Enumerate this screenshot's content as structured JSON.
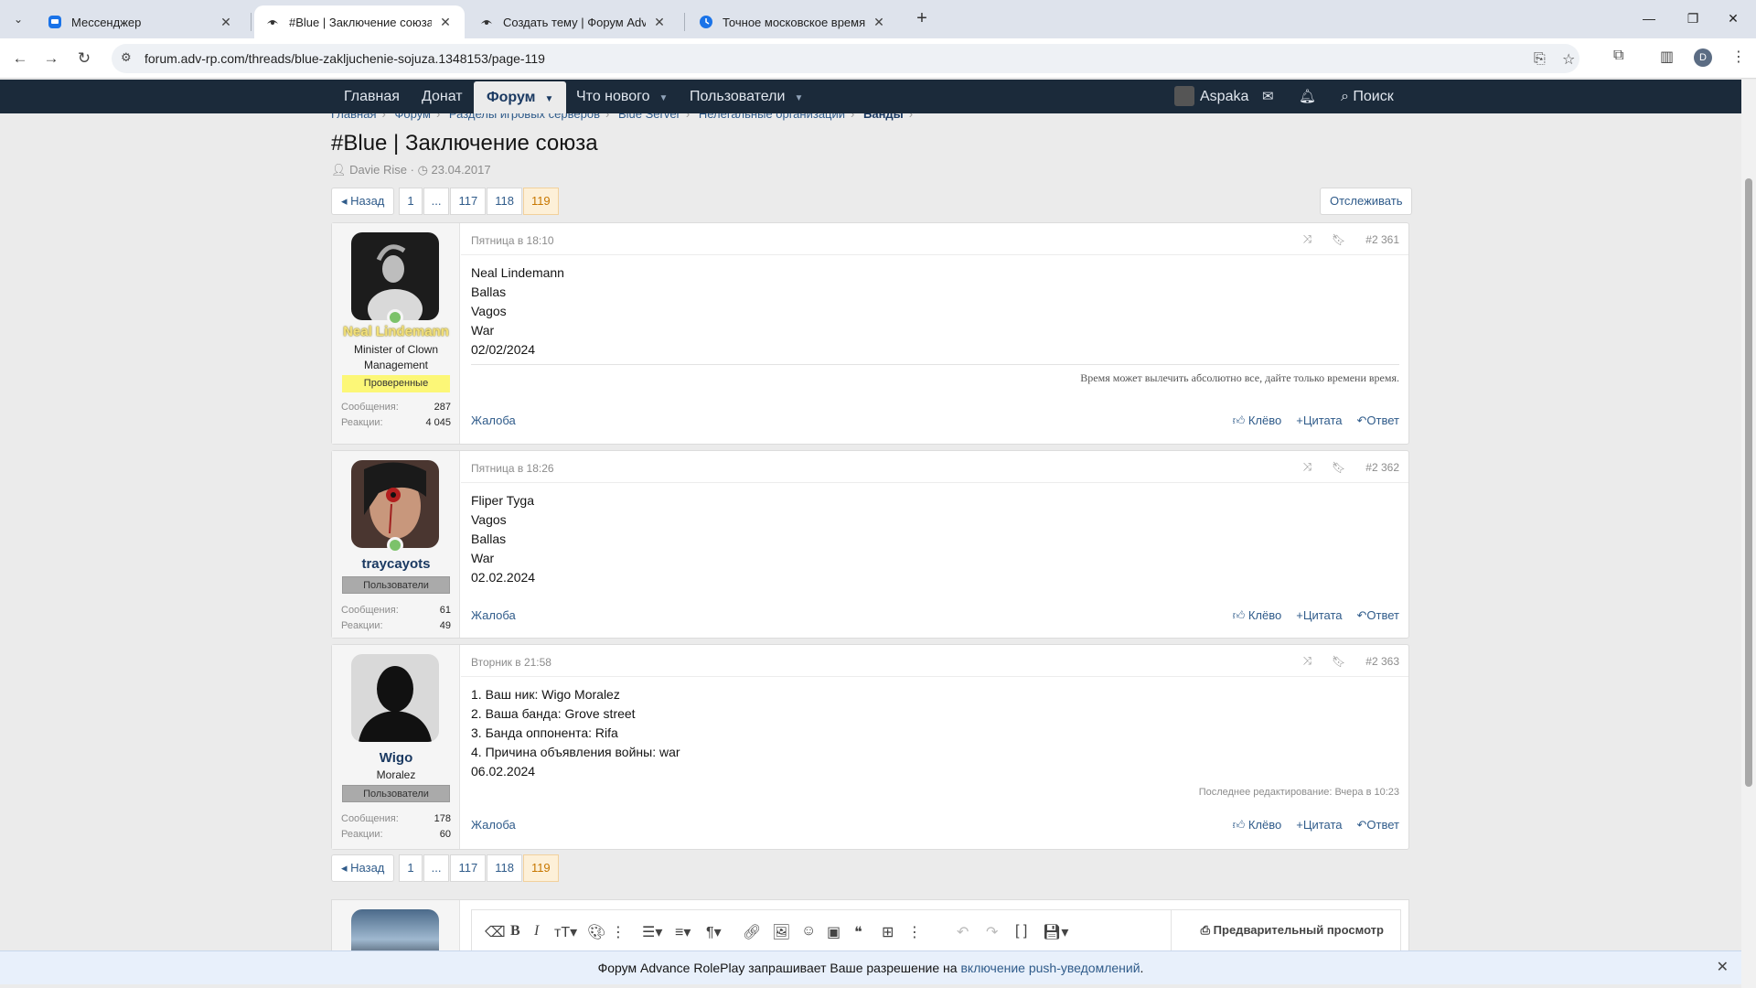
{
  "browser": {
    "tabs": [
      {
        "title": "Мессенджер",
        "favicon": "messenger-icon"
      },
      {
        "title": "#Blue | Заключение союза | Ст",
        "favicon": "forum-icon"
      },
      {
        "title": "Создать тему | Форум Advance",
        "favicon": "forum-icon"
      },
      {
        "title": "Точное московское время",
        "favicon": "clock-icon"
      }
    ],
    "url": "forum.adv-rp.com/threads/blue-zakljuchenie-sojuza.1348153/page-119",
    "profile_initial": "D"
  },
  "nav": {
    "items": [
      "Главная",
      "Донат",
      "Форум",
      "Что нового",
      "Пользователи"
    ],
    "user": "Aspaka",
    "search": "Поиск"
  },
  "breadcrumbs": [
    "Главная",
    "Форум",
    "Разделы игровых серверов",
    "Blue Server",
    "Нелегальные организации",
    "Банды"
  ],
  "thread": {
    "title": "#Blue | Заключение союза",
    "author": "Davie Rise",
    "date": "23.04.2017",
    "watch": "Отслеживать"
  },
  "pagination": {
    "prev": "Назад",
    "pages": [
      "1",
      "...",
      "117",
      "118",
      "119"
    ],
    "current": "119"
  },
  "posts": [
    {
      "username": "Neal Lindemann",
      "user_title": "Minister of Clown Management",
      "banner": "Проверенные",
      "messages_label": "Сообщения:",
      "messages": "287",
      "reactions_label": "Реакции:",
      "reactions": "4 045",
      "time": "Пятница в 18:10",
      "number": "#2 361",
      "lines": [
        "Neal Lindemann",
        "Ballas",
        "Vagos",
        "War",
        "02/02/2024"
      ],
      "signature": "Время может вылечить абсолютно все, дайте только времени время.",
      "report": "Жалоба",
      "like": "Клёво",
      "quote": "Цитата",
      "reply": "Ответ"
    },
    {
      "username": "traycayots",
      "banner": "Пользователи",
      "messages_label": "Сообщения:",
      "messages": "61",
      "reactions_label": "Реакции:",
      "reactions": "49",
      "time": "Пятница в 18:26",
      "number": "#2 362",
      "lines": [
        "Fliper Tyga",
        "Vagos",
        "Ballas",
        "War",
        "02.02.2024"
      ],
      "report": "Жалоба",
      "like": "Клёво",
      "quote": "Цитата",
      "reply": "Ответ"
    },
    {
      "username": "Wigo",
      "user_title": "Moralez",
      "banner": "Пользователи",
      "messages_label": "Сообщения:",
      "messages": "178",
      "reactions_label": "Реакции:",
      "reactions": "60",
      "time": "Вторник в 21:58",
      "number": "#2 363",
      "lines": [
        "1. Ваш ник: Wigo Moralez",
        "2. Ваша банда: Grove street",
        "3. Банда оппонента: Rifa",
        "4. Причина объявления войны: war",
        "06.02.2024"
      ],
      "edited": "Последнее редактирование: Вчера в 10:23",
      "report": "Жалоба",
      "like": "Клёво",
      "quote": "Цитата",
      "reply": "Ответ"
    }
  ],
  "editor": {
    "preview": "Предварительный просмотр"
  },
  "notice": {
    "text": "Форум Advance RolePlay запрашивает Ваше разрешение на",
    "link": "включение push-уведомлений",
    "tail": "."
  }
}
